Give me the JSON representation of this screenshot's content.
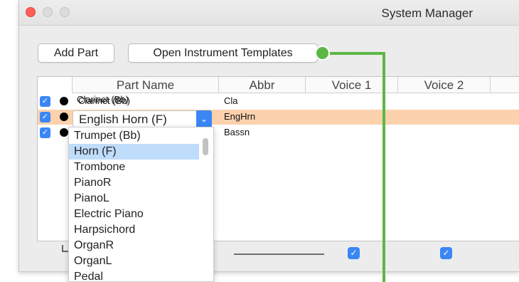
{
  "window": {
    "title": "System Manager"
  },
  "toolbar": {
    "add_part_label": "Add Part",
    "open_templates_label": "Open Instrument Templates"
  },
  "table": {
    "columns": [
      "Part Name",
      "Abbr",
      "Voice 1",
      "Voice 2"
    ],
    "rows": [
      {
        "checked": true,
        "name": "Clarinet (Bb)",
        "abbr": "Cla",
        "selected": false
      },
      {
        "checked": true,
        "name": "English Horn (F)",
        "abbr": "EngHrn",
        "selected": true
      },
      {
        "checked": true,
        "name": "",
        "abbr": "Bassn",
        "selected": false
      }
    ]
  },
  "part_popup": {
    "value": "English Horn (F)"
  },
  "dropdown": {
    "options": [
      "Trumpet (Bb)",
      "Horn (F)",
      "Trombone",
      "PianoR",
      "PianoL",
      "Electric Piano",
      "Harpsichord",
      "OrganR",
      "OrganL",
      "Pedal"
    ],
    "highlighted_index": 1
  },
  "footer": {
    "voice1_checked": true,
    "voice2_checked": true
  },
  "icons": {
    "checkmark": "✓",
    "chevron": "⌄"
  },
  "colors": {
    "accent": "#3b86f5",
    "selected_row": "#fcd1ad",
    "highlight": "#bfdcfb",
    "annotation": "#5cb845"
  }
}
